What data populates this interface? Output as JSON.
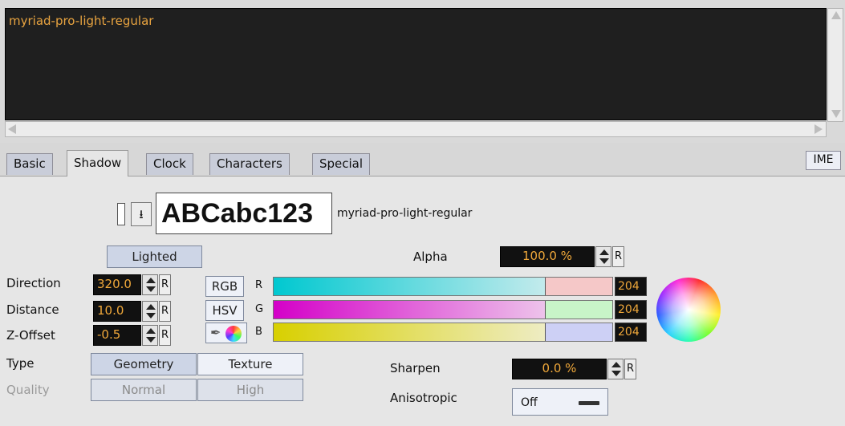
{
  "editor": {
    "text": "myriad-pro-light-regular"
  },
  "tabs": [
    {
      "label": "Basic"
    },
    {
      "label": "Shadow"
    },
    {
      "label": "Clock"
    },
    {
      "label": "Characters"
    },
    {
      "label": "Special"
    }
  ],
  "ime_label": "IME",
  "font": {
    "preview": "ABCabc123",
    "name": "myriad-pro-light-regular"
  },
  "lighted_label": "Lighted",
  "alpha": {
    "label": "Alpha",
    "value": "100.0 %",
    "reset": "R"
  },
  "direction": {
    "label": "Direction",
    "value": "320.0",
    "reset": "R"
  },
  "distance": {
    "label": "Distance",
    "value": "10.0",
    "reset": "R"
  },
  "zoffset": {
    "label": "Z-Offset",
    "value": "-0.5",
    "reset": "R"
  },
  "color_modes": {
    "rgb": "RGB",
    "hsv": "HSV"
  },
  "channels": [
    {
      "label": "R",
      "value": "204"
    },
    {
      "label": "G",
      "value": "204"
    },
    {
      "label": "B",
      "value": "204"
    }
  ],
  "type": {
    "label": "Type",
    "options": [
      "Geometry",
      "Texture"
    ],
    "selected": "Texture"
  },
  "quality": {
    "label": "Quality",
    "options": [
      "Normal",
      "High"
    ]
  },
  "sharpen": {
    "label": "Sharpen",
    "value": "0.0 %",
    "reset": "R"
  },
  "anisotropic": {
    "label": "Anisotropic",
    "value": "Off"
  },
  "colors": {
    "accent_text": "#f0a83a",
    "editor_bg": "#1f1f1f",
    "button_bg": "#cdd5e6"
  }
}
